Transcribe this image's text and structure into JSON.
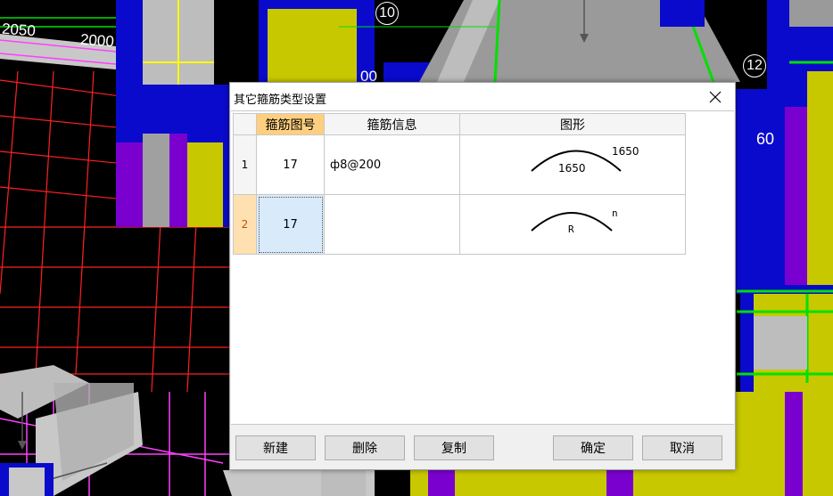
{
  "background": {
    "dimension_labels": [
      "2050",
      "2000"
    ],
    "axis_bubbles": [
      "10",
      "12",
      "60"
    ],
    "floor_marker": "00"
  },
  "dialog": {
    "title": "其它箍筋类型设置",
    "close_glyph": "✕",
    "table": {
      "columns": [
        "箍筋图号",
        "箍筋信息",
        "图形"
      ],
      "rows": [
        {
          "index": "1",
          "figure_no": "17",
          "info": "ф8@200",
          "shape_top_label": "1650",
          "shape_inner_label": "1650"
        },
        {
          "index": "2",
          "figure_no": "17",
          "info": "",
          "shape_top_label": "n",
          "shape_inner_label": "R"
        }
      ],
      "selected_row": 2
    },
    "buttons": {
      "new": "新建",
      "delete": "删除",
      "copy": "复制",
      "ok": "确定",
      "cancel": "取消"
    }
  },
  "colors": {
    "cad_background": "#000000",
    "grid_red": "#ff2020",
    "column_blue": "#0a0acc",
    "column_purple": "#7a00d0",
    "column_yellow": "#c8c800",
    "green": "#00e000",
    "magenta": "#ff40ff",
    "header_highlight": "#ffcf80",
    "selected_cell": "#d9ebfa"
  }
}
